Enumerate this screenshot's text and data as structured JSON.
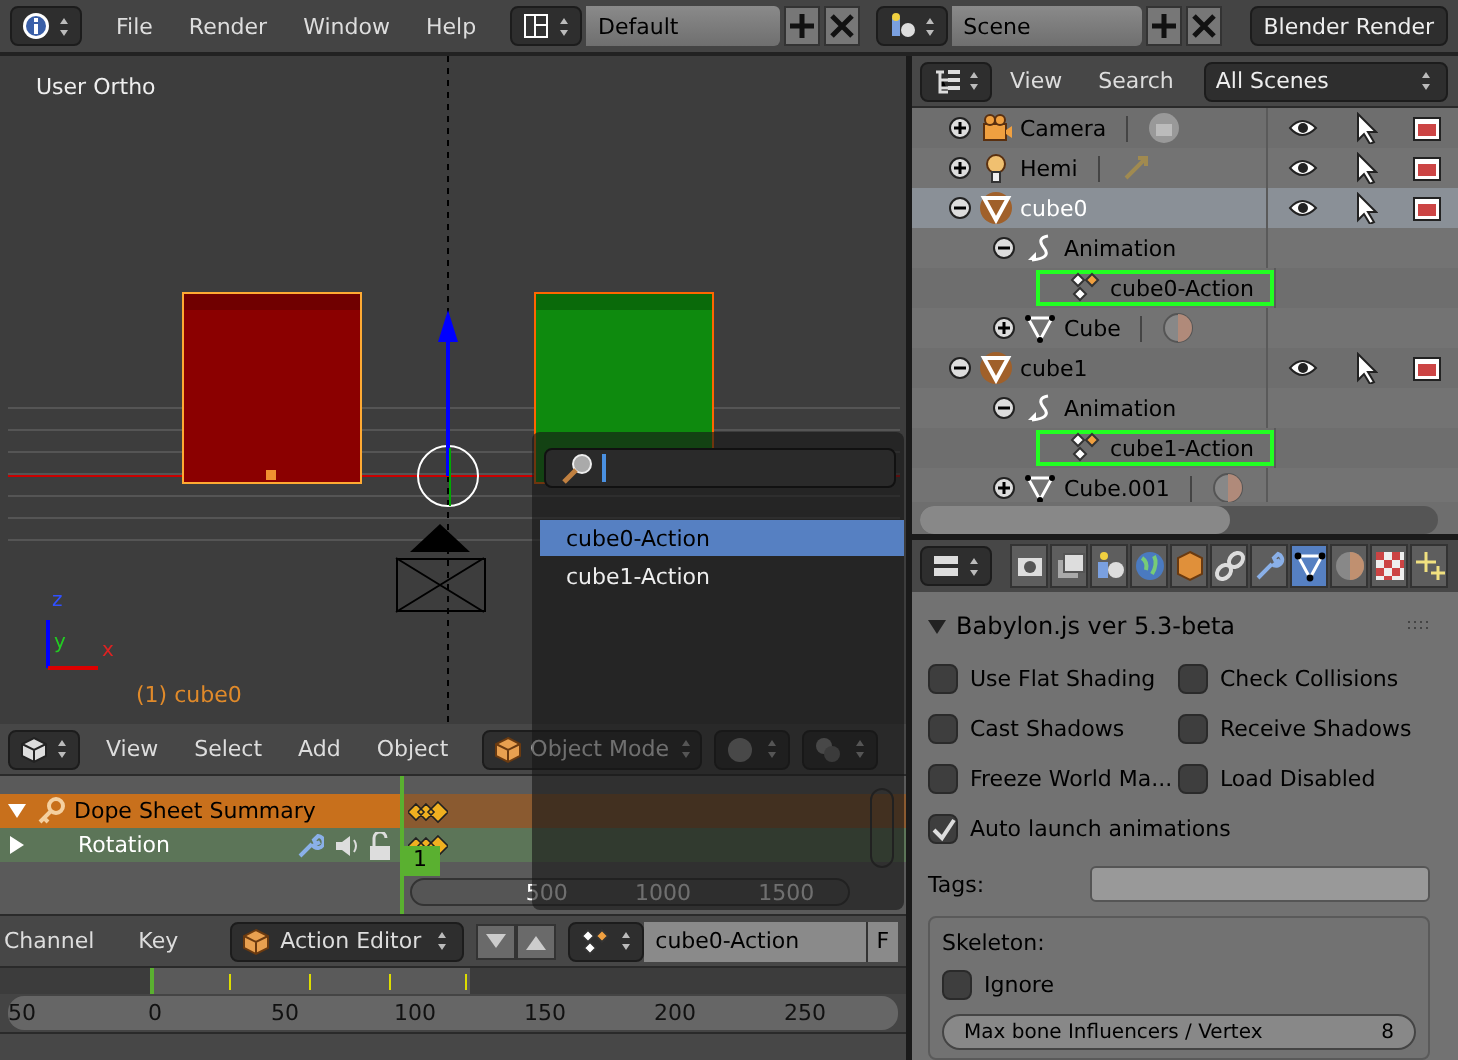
{
  "topbar": {
    "menus": [
      "File",
      "Render",
      "Window",
      "Help"
    ],
    "layout": "Default",
    "scene": "Scene",
    "engine": "Blender Render"
  },
  "viewport": {
    "view_name": "User Ortho",
    "object_label": "(1) cube0",
    "axis_labels": [
      "z",
      "y",
      "x"
    ]
  },
  "viewport_header": {
    "menus": [
      "View",
      "Select",
      "Add",
      "Object"
    ],
    "mode": "Object Mode"
  },
  "dope_sheet": {
    "channels": [
      {
        "kind": "summary",
        "label": "Dope Sheet Summary",
        "expanded": true
      },
      {
        "kind": "group",
        "label": "Rotation",
        "expanded": false
      }
    ],
    "current_frame": "1",
    "scroll_labels": [
      "500",
      "1000",
      "1500"
    ]
  },
  "dope_header": {
    "menus": [
      "Channel",
      "Key"
    ],
    "editor_mode": "Action Editor",
    "action": "cube0-Action",
    "fake_user": "F"
  },
  "timeline": {
    "ticks": [
      "50",
      "0",
      "50",
      "100",
      "150",
      "200",
      "250"
    ]
  },
  "outliner": {
    "menus": [
      "View",
      "Search"
    ],
    "filter": "All Scenes",
    "rows": [
      {
        "kind": "camera",
        "name": "Camera",
        "expanded": false,
        "selected": false
      },
      {
        "kind": "lamp",
        "name": "Hemi",
        "expanded": false,
        "selected": false
      },
      {
        "kind": "mesh",
        "name": "cube0",
        "expanded": true,
        "selected": true,
        "children": [
          {
            "kind": "animation",
            "name": "Animation",
            "expanded": true,
            "selected": false,
            "children": [
              {
                "kind": "action",
                "name": "cube0-Action",
                "selected": false,
                "outlined": true
              }
            ]
          },
          {
            "kind": "meshdata",
            "name": "Cube",
            "expanded": false,
            "selected": false
          }
        ]
      },
      {
        "kind": "mesh",
        "name": "cube1",
        "expanded": true,
        "selected": false,
        "children": [
          {
            "kind": "animation",
            "name": "Animation",
            "expanded": true,
            "selected": false,
            "children": [
              {
                "kind": "action",
                "name": "cube1-Action",
                "selected": false,
                "outlined": true
              }
            ]
          },
          {
            "kind": "meshdata",
            "name": "Cube.001",
            "expanded": false,
            "selected": false
          }
        ]
      }
    ]
  },
  "properties": {
    "tabs": [
      {
        "kind": "render",
        "selected": false
      },
      {
        "kind": "render_layers",
        "selected": false
      },
      {
        "kind": "scene",
        "selected": false
      },
      {
        "kind": "world",
        "selected": false
      },
      {
        "kind": "object",
        "selected": false
      },
      {
        "kind": "constraints",
        "selected": false
      },
      {
        "kind": "modifiers",
        "selected": false
      },
      {
        "kind": "data",
        "selected": true
      },
      {
        "kind": "material",
        "selected": false
      },
      {
        "kind": "texture",
        "selected": false
      },
      {
        "kind": "particles",
        "selected": false
      }
    ],
    "panel_title": "Babylon.js ver 5.3-beta",
    "panel_expanded": true,
    "options": [
      {
        "label": "Use Flat Shading",
        "checked": false
      },
      {
        "label": "Check Collisions",
        "checked": false
      },
      {
        "label": "Cast Shadows",
        "checked": false
      },
      {
        "label": "Receive Shadows",
        "checked": false
      },
      {
        "label": "Freeze World Ma...",
        "checked": false
      },
      {
        "label": "Load Disabled",
        "checked": false
      },
      {
        "label": "Auto launch animations",
        "checked": true
      }
    ],
    "tags_label": "Tags:",
    "skeleton_label": "Skeleton:",
    "ignore": {
      "label": "Ignore",
      "checked": false
    },
    "max_bone": {
      "label": "Max bone Influencers / Vertex",
      "value": "8"
    }
  },
  "search_popup": {
    "items": [
      {
        "label": "cube0-Action",
        "selected": true
      },
      {
        "label": "cube1-Action",
        "selected": false
      }
    ]
  }
}
